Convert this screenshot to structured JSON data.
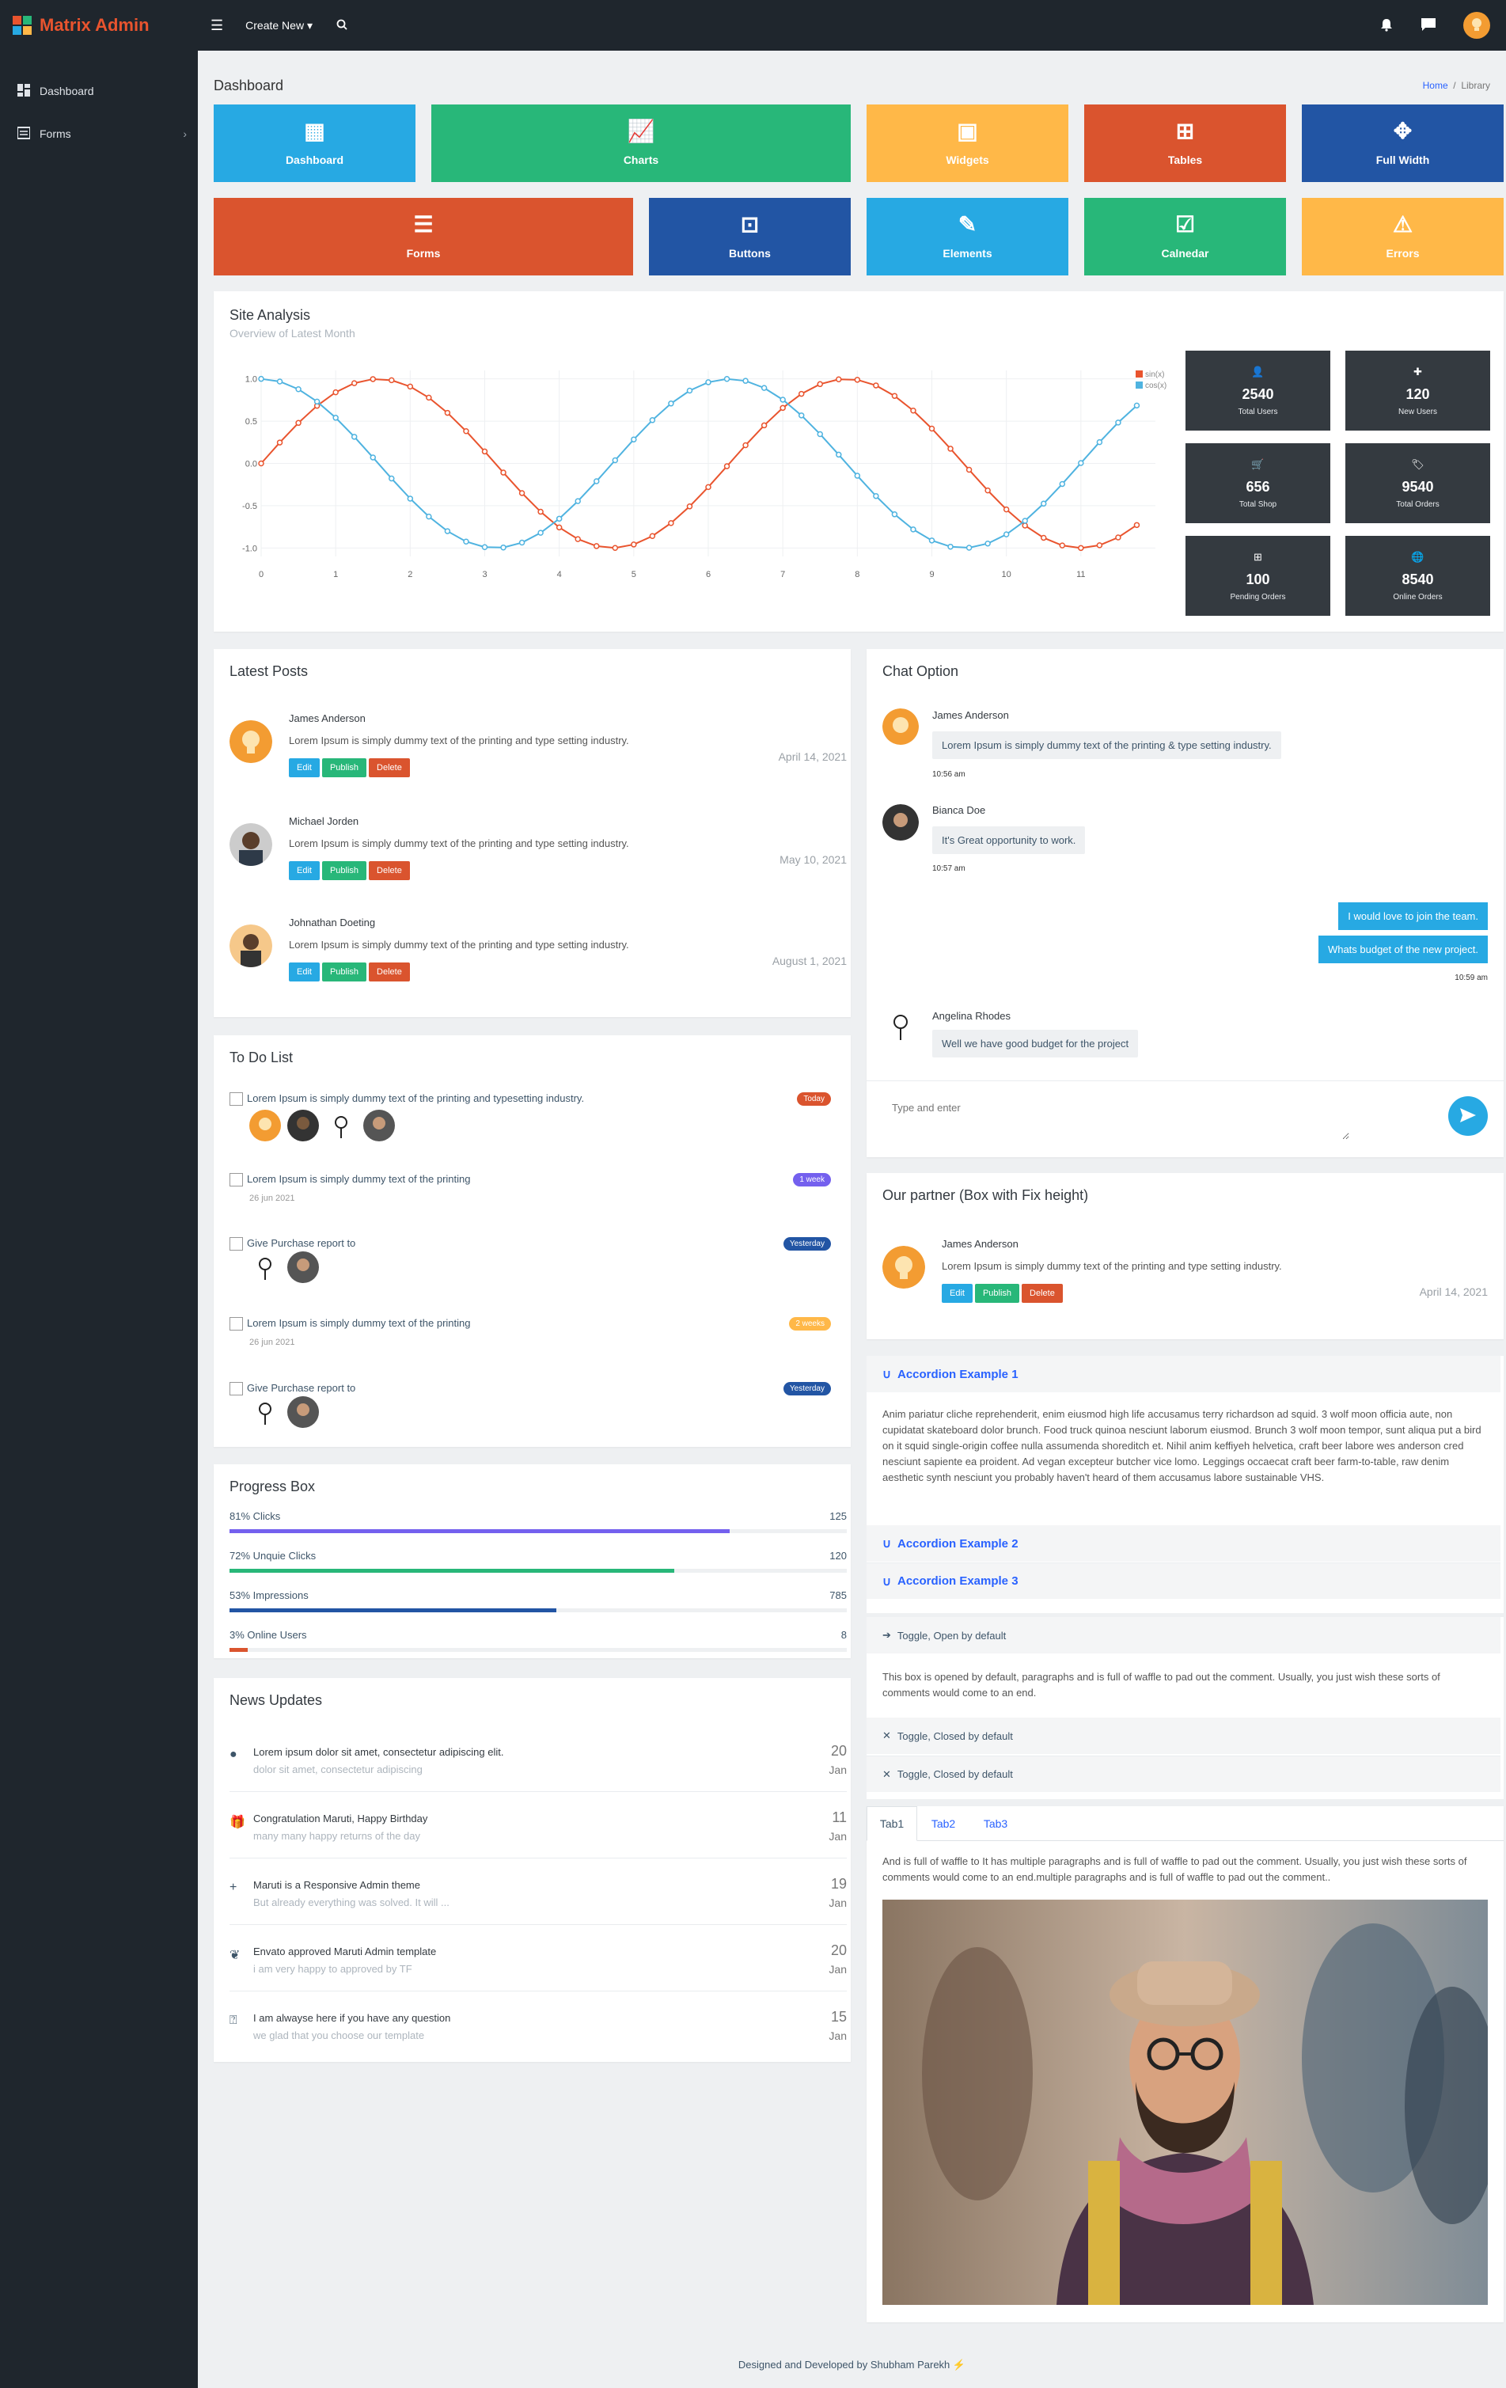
{
  "app": {
    "name": "Matrix Admin"
  },
  "topbar": {
    "create_new": "Create New"
  },
  "sidebar": {
    "items": [
      {
        "label": "Dashboard"
      },
      {
        "label": "Forms"
      }
    ]
  },
  "page": {
    "title": "Dashboard",
    "breadcrumb": [
      "Home",
      "Library"
    ]
  },
  "tiles": [
    {
      "label": "Dashboard",
      "color": "#27a9e3",
      "icon": "dashboard-icon"
    },
    {
      "label": "Charts",
      "color": "#28b779",
      "icon": "area-chart-icon"
    },
    {
      "label": "Widgets",
      "color": "#ffb848",
      "icon": "widgets-icon"
    },
    {
      "label": "Tables",
      "color": "#da542e",
      "icon": "table-icon"
    },
    {
      "label": "Full Width",
      "color": "#2255a4",
      "icon": "arrows-icon"
    },
    {
      "label": "Forms",
      "color": "#da542e",
      "icon": "form-icon"
    },
    {
      "label": "Buttons",
      "color": "#2255a4",
      "icon": "buttons-icon"
    },
    {
      "label": "Elements",
      "color": "#27a9e3",
      "icon": "pencil-icon"
    },
    {
      "label": "Calnedar",
      "color": "#28b779",
      "icon": "calendar-icon"
    },
    {
      "label": "Errors",
      "color": "#ffb848",
      "icon": "warning-icon"
    }
  ],
  "site_analysis": {
    "title": "Site Analysis",
    "subtitle": "Overview of Latest Month",
    "stats": [
      {
        "value": "2540",
        "label": "Total Users",
        "icon": "user-icon"
      },
      {
        "value": "120",
        "label": "New Users",
        "icon": "plus-icon"
      },
      {
        "value": "656",
        "label": "Total Shop",
        "icon": "cart-icon"
      },
      {
        "value": "9540",
        "label": "Total Orders",
        "icon": "tag-icon"
      },
      {
        "value": "100",
        "label": "Pending Orders",
        "icon": "table-icon"
      },
      {
        "value": "8540",
        "label": "Online Orders",
        "icon": "globe-icon"
      }
    ]
  },
  "chart_data": {
    "type": "line",
    "title": "",
    "xlabel": "",
    "ylabel": "",
    "x_ticks": [
      "0",
      "1",
      "2",
      "3",
      "4",
      "5",
      "6",
      "7",
      "8",
      "9",
      "10",
      "11"
    ],
    "y_ticks": [
      "1.0",
      "0.5",
      "0.0",
      "-0.5",
      "-1.0"
    ],
    "xlim": [
      0,
      12
    ],
    "ylim": [
      -1.1,
      1.1
    ],
    "grid": true,
    "legend": "top-right",
    "series": [
      {
        "name": "sin(x)",
        "color": "#e9542e",
        "function": "sin",
        "x_start": 0,
        "x_step": 0.25,
        "points": 48
      },
      {
        "name": "cos(x)",
        "color": "#4fb3e0",
        "function": "cos",
        "x_start": 0,
        "x_step": 0.25,
        "points": 48
      }
    ]
  },
  "latest_posts": {
    "title": "Latest Posts",
    "buttons": {
      "edit": "Edit",
      "publish": "Publish",
      "delete": "Delete"
    },
    "items": [
      {
        "name": "James Anderson",
        "text": "Lorem Ipsum is simply dummy text of the printing and type setting industry.",
        "date": "April 14, 2021"
      },
      {
        "name": "Michael Jorden",
        "text": "Lorem Ipsum is simply dummy text of the printing and type setting industry.",
        "date": "May 10, 2021"
      },
      {
        "name": "Johnathan Doeting",
        "text": "Lorem Ipsum is simply dummy text of the printing and type setting industry.",
        "date": "August 1, 2021"
      }
    ]
  },
  "todo": {
    "title": "To Do List",
    "items": [
      {
        "text": "Lorem Ipsum is simply dummy text of the printing and typesetting industry.",
        "badge": "Today",
        "badge_color": "#da542e",
        "date": ""
      },
      {
        "text": "Lorem Ipsum is simply dummy text of the printing",
        "badge": "1 week",
        "badge_color": "#7460ee",
        "date": "26 jun 2021"
      },
      {
        "text": "Give Purchase report to",
        "badge": "Yesterday",
        "badge_color": "#2255a4",
        "date": ""
      },
      {
        "text": "Lorem Ipsum is simply dummy text of the printing",
        "badge": "2 weeks",
        "badge_color": "#ffb848",
        "date": "26 jun 2021"
      },
      {
        "text": "Give Purchase report to",
        "badge": "Yesterday",
        "badge_color": "#2255a4",
        "date": ""
      }
    ]
  },
  "progress": {
    "title": "Progress Box",
    "items": [
      {
        "label": "81% Clicks",
        "value": "125",
        "percent": 81,
        "color": "#7460ee"
      },
      {
        "label": "72% Unquie Clicks",
        "value": "120",
        "percent": 72,
        "color": "#28b779"
      },
      {
        "label": "53% Impressions",
        "value": "785",
        "percent": 53,
        "color": "#2255a4"
      },
      {
        "label": "3% Online Users",
        "value": "8",
        "percent": 3,
        "color": "#da542e"
      }
    ]
  },
  "news": {
    "title": "News Updates",
    "items": [
      {
        "title": "Lorem ipsum dolor sit amet, consectetur adipiscing elit.",
        "sub": "dolor sit amet, consectetur adipiscing",
        "day": "20",
        "month": "Jan",
        "icon": "check-circle-icon"
      },
      {
        "title": "Congratulation Maruti, Happy Birthday",
        "sub": "many many happy returns of the day",
        "day": "11",
        "month": "Jan",
        "icon": "gift-icon"
      },
      {
        "title": "Maruti is a Responsive Admin theme",
        "sub": "But already everything was solved. It will ...",
        "day": "19",
        "month": "Jan",
        "icon": "plus-icon"
      },
      {
        "title": "Envato approved Maruti Admin template",
        "sub": "i am very happy to approved by TF",
        "day": "20",
        "month": "Jan",
        "icon": "leaf-icon"
      },
      {
        "title": "I am alwayse here if you have any question",
        "sub": "we glad that you choose our template",
        "day": "15",
        "month": "Jan",
        "icon": "question-icon"
      }
    ]
  },
  "chat": {
    "title": "Chat Option",
    "placeholder": "Type and enter",
    "messages": [
      {
        "name": "James Anderson",
        "text": "Lorem Ipsum is simply dummy text of the printing & type setting industry.",
        "time": "10:56 am"
      },
      {
        "name": "Bianca Doe",
        "text": "It's Great opportunity to work.",
        "time": "10:57 am"
      },
      {
        "text": "I would love to join the team."
      },
      {
        "text": "Whats budget of the new project.",
        "time": "10:59 am"
      },
      {
        "name": "Angelina Rhodes",
        "text": "Well we have good budget for the project"
      }
    ]
  },
  "partner": {
    "title": "Our partner (Box with Fix height)",
    "name": "James Anderson",
    "text": "Lorem Ipsum is simply dummy text of the printing and type setting industry.",
    "date": "April 14, 2021"
  },
  "accordion": {
    "items": [
      "Accordion Example 1",
      "Accordion Example 2",
      "Accordion Example 3"
    ],
    "body": "Anim pariatur cliche reprehenderit, enim eiusmod high life accusamus terry richardson ad squid. 3 wolf moon officia aute, non cupidatat skateboard dolor brunch. Food truck quinoa nesciunt laborum eiusmod. Brunch 3 wolf moon tempor, sunt aliqua put a bird on it squid single-origin coffee nulla assumenda shoreditch et. Nihil anim keffiyeh helvetica, craft beer labore wes anderson cred nesciunt sapiente ea proident. Ad vegan excepteur butcher vice lomo. Leggings occaecat craft beer farm-to-table, raw denim aesthetic synth nesciunt you probably haven't heard of them accusamus labore sustainable VHS."
  },
  "toggles": {
    "open": "Toggle, Open by default",
    "open_body": "This box is opened by default, paragraphs and is full of waffle to pad out the comment. Usually, you just wish these sorts of comments would come to an end.",
    "closed1": "Toggle, Closed by default",
    "closed2": "Toggle, Closed by default"
  },
  "tabs": {
    "labels": [
      "Tab1",
      "Tab2",
      "Tab3"
    ],
    "body": "And is full of waffle to It has multiple paragraphs and is full of waffle to pad out the comment. Usually, you just wish these sorts of comments would come to an end.multiple paragraphs and is full of waffle to pad out the comment.."
  },
  "footer": "Designed and Developed by Shubham Parekh"
}
